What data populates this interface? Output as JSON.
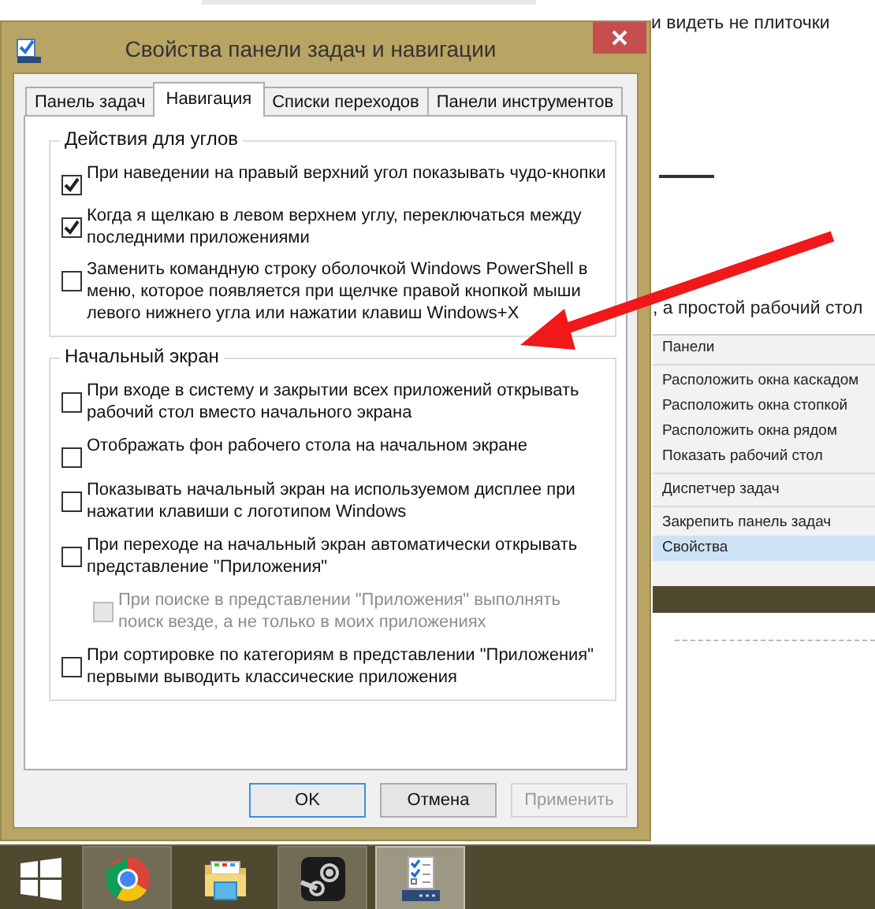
{
  "background_page": {
    "texts": [
      "и видеть не плиточки",
      ", а простой рабочий стол"
    ]
  },
  "context_menu": {
    "groups": [
      [
        {
          "label": "Панели",
          "selected": false
        }
      ],
      [
        {
          "label": "Расположить окна каскадом",
          "selected": false
        },
        {
          "label": "Расположить окна стопкой",
          "selected": false
        },
        {
          "label": "Расположить окна рядом",
          "selected": false
        },
        {
          "label": "Показать рабочий стол",
          "selected": false
        }
      ],
      [
        {
          "label": "Диспетчер задач",
          "selected": false
        }
      ],
      [
        {
          "label": "Закрепить панель задач",
          "selected": false
        },
        {
          "label": "Свойства",
          "selected": true
        }
      ]
    ]
  },
  "dialog": {
    "title": "Свойства панели задач и навигации",
    "tabs": [
      {
        "label": "Панель задач",
        "selected": false
      },
      {
        "label": "Навигация",
        "selected": true
      },
      {
        "label": "Списки переходов",
        "selected": false
      },
      {
        "label": "Панели инструментов",
        "selected": false
      }
    ],
    "groups": [
      {
        "title": "Действия для углов",
        "options": [
          {
            "label": "При наведении на правый верхний угол показывать чудо-кнопки",
            "checked": true,
            "disabled": false
          },
          {
            "label": "Когда я щелкаю в левом верхнем углу, переключаться между последними приложениями",
            "checked": true,
            "disabled": false
          },
          {
            "label": "Заменить командную строку оболочкой Windows PowerShell в меню, которое появляется при щелчке правой кнопкой мыши левого нижнего угла или нажатии клавиш Windows+X",
            "checked": false,
            "disabled": false
          }
        ]
      },
      {
        "title": "Начальный экран",
        "options": [
          {
            "label": "При входе в систему и закрытии всех приложений открывать рабочий стол вместо начального экрана",
            "checked": false,
            "disabled": false
          },
          {
            "label": "Отображать фон рабочего стола на начальном экране",
            "checked": false,
            "disabled": false
          },
          {
            "label": "Показывать начальный экран на используемом дисплее при нажатии клавиши с логотипом Windows",
            "checked": false,
            "disabled": false
          },
          {
            "label": "При переходе на начальный экран автоматически открывать представление \"Приложения\"",
            "checked": false,
            "disabled": false,
            "children": [
              {
                "label": "При поиске в представлении \"Приложения\" выполнять поиск везде, а не только в моих приложениях",
                "checked": false,
                "disabled": true
              }
            ]
          },
          {
            "label": "При сортировке по категориям в представлении \"Приложения\" первыми выводить классические приложения",
            "checked": false,
            "disabled": false
          }
        ]
      }
    ],
    "buttons": [
      {
        "label": "OK",
        "default": true,
        "disabled": false
      },
      {
        "label": "Отмена",
        "default": false,
        "disabled": false
      },
      {
        "label": "Применить",
        "default": false,
        "disabled": true
      }
    ]
  },
  "taskbar": {
    "items": [
      {
        "kind": "chrome",
        "running": true,
        "selected": false
      },
      {
        "kind": "explorer",
        "running": false,
        "selected": false
      },
      {
        "kind": "steam",
        "running": true,
        "selected": false
      },
      {
        "kind": "properties",
        "running": true,
        "selected": true
      }
    ]
  }
}
